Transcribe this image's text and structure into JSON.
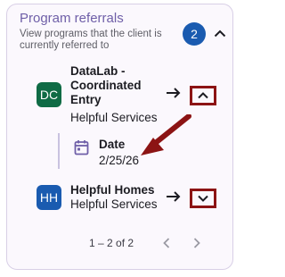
{
  "panel": {
    "title": "Program referrals",
    "subtitle": "View programs that the client is currently referred to",
    "count": "2"
  },
  "referrals": [
    {
      "initials": "DC",
      "name": "DataLab - Coordinated Entry",
      "organization": "Helpful Services",
      "avatar_color": "#0f6b45",
      "expanded": true,
      "detail": {
        "label": "Date",
        "value": "2/25/26",
        "icon": "calendar-icon"
      }
    },
    {
      "initials": "HH",
      "name": "Helpful Homes",
      "organization": "Helpful Services",
      "avatar_color": "#1a5bb0",
      "expanded": false
    }
  ],
  "pagination": {
    "range": "1 – 2 of 2"
  },
  "colors": {
    "accent": "#6f5fa8",
    "badge": "#1a5bb0",
    "annotation": "#8c1414"
  },
  "icons": {
    "collapse": "chevron-up-icon",
    "open": "arrow-right-icon",
    "expand": "chevron-down-icon",
    "prev": "chevron-left-icon",
    "next": "chevron-right-icon"
  }
}
